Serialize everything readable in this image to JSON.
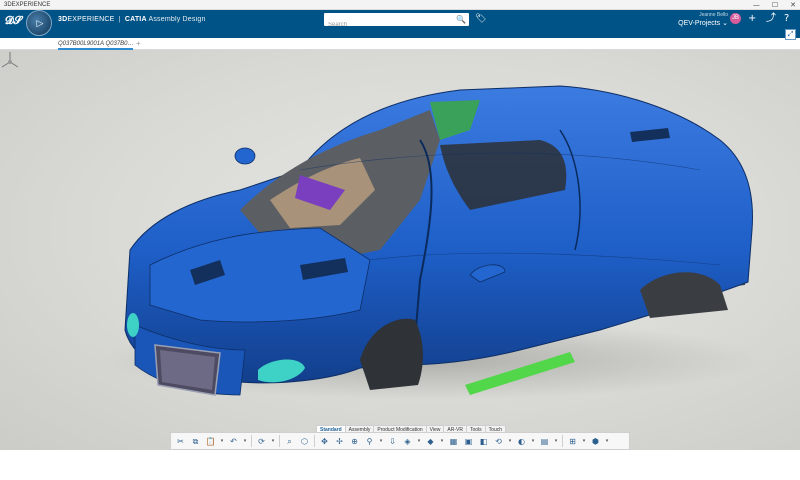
{
  "window": {
    "title": "3DEXPERIENCE",
    "minimize": "—",
    "maximize": "☐",
    "close": "✕"
  },
  "header": {
    "brand_bold": "3D",
    "brand_rest": "EXPERIENCE",
    "separator": "|",
    "app": "CATIA",
    "module": "Assembly Design",
    "search_placeholder": "Search",
    "user_name": "Jeanne Bello",
    "project": "QEV-Projects",
    "avatar_initials": "JB",
    "colors": {
      "header_bg": "#005386",
      "avatar_bg": "#d45c9a"
    }
  },
  "tabs": {
    "document": "Q037B00L9001A Q037B0…",
    "add": "+"
  },
  "viewport": {
    "object": "blue concept sports car body assembly",
    "colors": {
      "body": "#1f62c9",
      "lights": "#3ed2c6",
      "accent_green": "#52d64a",
      "background": "#dadad6"
    }
  },
  "actionbar": {
    "tabs": [
      {
        "label": "Standard",
        "active": true
      },
      {
        "label": "Assembly",
        "active": false
      },
      {
        "label": "Product Modification",
        "active": false
      },
      {
        "label": "View",
        "active": false
      },
      {
        "label": "AR-VR",
        "active": false
      },
      {
        "label": "Tools",
        "active": false
      },
      {
        "label": "Touch",
        "active": false
      }
    ],
    "tools": [
      "cut-icon",
      "copy-icon",
      "paste-icon",
      "undo-icon",
      "update-icon",
      "zoom-area-icon",
      "fit-all-icon",
      "pan-icon",
      "rotate-icon",
      "zoom-icon",
      "normal-view-icon",
      "view-mode-icon",
      "shading-icon",
      "ambient-icon",
      "capture-icon",
      "render-icon",
      "section-icon",
      "tree-icon",
      "box-icon"
    ]
  }
}
